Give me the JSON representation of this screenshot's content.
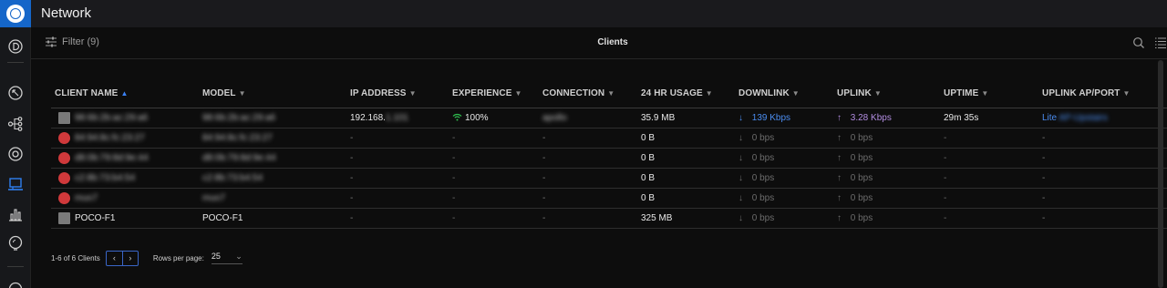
{
  "app": {
    "title": "Network"
  },
  "toolbar": {
    "filter_label": "Filter (9)",
    "page_title": "Clients"
  },
  "icons": {
    "logo": "ubiquiti-logo-icon",
    "nav": [
      "dashboard-icon",
      "topology-icon",
      "devices-icon",
      "clients-icon",
      "statistics-icon",
      "insights-icon"
    ],
    "filter": "filter-icon",
    "search": "search-icon",
    "columns": "column-settings-icon"
  },
  "colors": {
    "accent": "#1566c9",
    "downlink": "#4b8df0",
    "uplink": "#b28de0",
    "logo_bg": "#1566c9"
  },
  "table": {
    "columns": [
      {
        "label": "CLIENT NAME",
        "sort": "asc"
      },
      {
        "label": "MODEL",
        "sort": "none"
      },
      {
        "label": "IP ADDRESS",
        "sort": "none"
      },
      {
        "label": "EXPERIENCE",
        "sort": "none"
      },
      {
        "label": "CONNECTION",
        "sort": "none"
      },
      {
        "label": "24 HR USAGE",
        "sort": "none"
      },
      {
        "label": "DOWNLINK",
        "sort": "none"
      },
      {
        "label": "UPLINK",
        "sort": "none"
      },
      {
        "label": "UPTIME",
        "sort": "none"
      },
      {
        "label": "UPLINK AP/PORT",
        "sort": "none"
      }
    ],
    "rows": [
      {
        "icon": "laptop-icon",
        "name": "98:6b:2b:ac:29:a6",
        "model": "98:6b:2b:ac:29:a6",
        "ip": "192.168.",
        "ip_hidden": "1.101",
        "experience": "100%",
        "connection": "apollo",
        "usage": "35.9 MB",
        "downlink": "139 Kbps",
        "uplink": "3.28 Kbps",
        "uptime": "29m 35s",
        "ap": "Lite",
        "ap_hidden": "AP-Upstairs",
        "active": true
      },
      {
        "icon": "unknown-device-icon",
        "name": "84:94:8c:fc:23:27",
        "model": "84:94:8c:fc:23:27",
        "ip": "-",
        "experience": "-",
        "connection": "-",
        "usage": "0 B",
        "downlink": "0 bps",
        "uplink": "0 bps",
        "uptime": "-",
        "ap": "-",
        "active": false
      },
      {
        "icon": "unknown-device-icon",
        "name": "d8:0b:79:8d:9e:44",
        "model": "d8:0b:79:8d:9e:44",
        "ip": "-",
        "experience": "-",
        "connection": "-",
        "usage": "0 B",
        "downlink": "0 bps",
        "uplink": "0 bps",
        "uptime": "-",
        "ap": "-",
        "active": false
      },
      {
        "icon": "unknown-device-icon",
        "name": "c2:8b:73:b4:54",
        "model": "c2:8b:73:b4:54",
        "ip": "-",
        "experience": "-",
        "connection": "-",
        "usage": "0 B",
        "downlink": "0 bps",
        "uplink": "0 bps",
        "uptime": "-",
        "ap": "-",
        "active": false
      },
      {
        "icon": "unknown-device-icon",
        "name": "muo7",
        "model": "muo7",
        "ip": "-",
        "experience": "-",
        "connection": "-",
        "usage": "0 B",
        "downlink": "0 bps",
        "uplink": "0 bps",
        "uptime": "-",
        "ap": "-",
        "active": false
      },
      {
        "icon": "phone-icon",
        "name": "POCO-F1",
        "model": "POCO-F1",
        "ip": "-",
        "experience": "-",
        "connection": "-",
        "usage": "325 MB",
        "downlink": "0 bps",
        "uplink": "0 bps",
        "uptime": "-",
        "ap": "-",
        "active": false
      }
    ]
  },
  "footer": {
    "range_label": "1-6 of 6 Clients",
    "prev": "‹",
    "next": "›",
    "rows_per_page_label": "Rows per page:",
    "rows_per_page_value": "25"
  }
}
